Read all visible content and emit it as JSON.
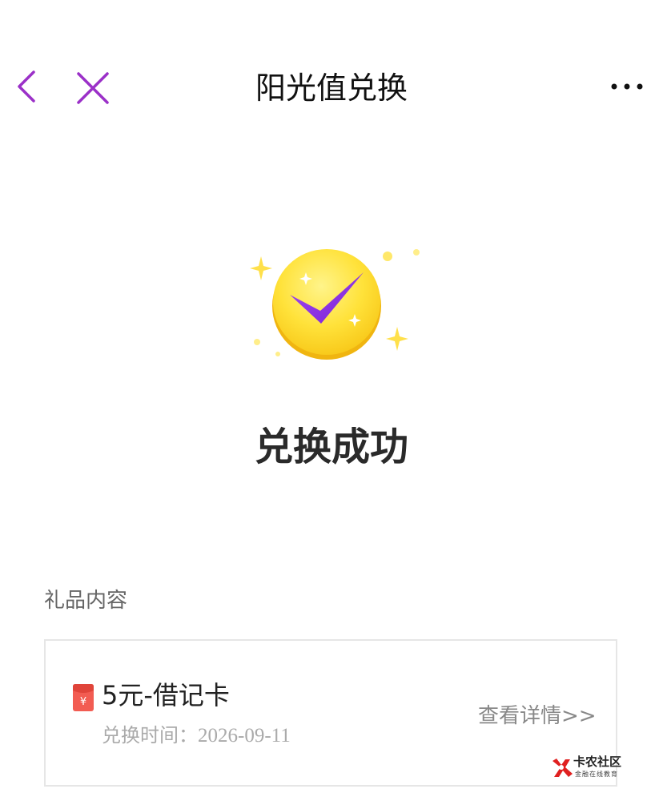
{
  "header": {
    "title": "阳光值兑换",
    "back_icon": "back-chevron-icon",
    "close_icon": "close-x-icon",
    "more_icon": "more-dots-icon",
    "accent_color": "#9b30c8"
  },
  "result": {
    "status_text": "兑换成功",
    "illustration_icon": "check-coin-icon"
  },
  "gift": {
    "section_label": "礼品内容",
    "name": "5元-借记卡",
    "time_label": "兑换时间：",
    "time_value": "2026-09-11",
    "detail_link": "查看详情>>",
    "item_icon": "red-envelope-icon"
  },
  "watermark": {
    "title": "卡农社区",
    "subtitle": "金融在线教育"
  }
}
